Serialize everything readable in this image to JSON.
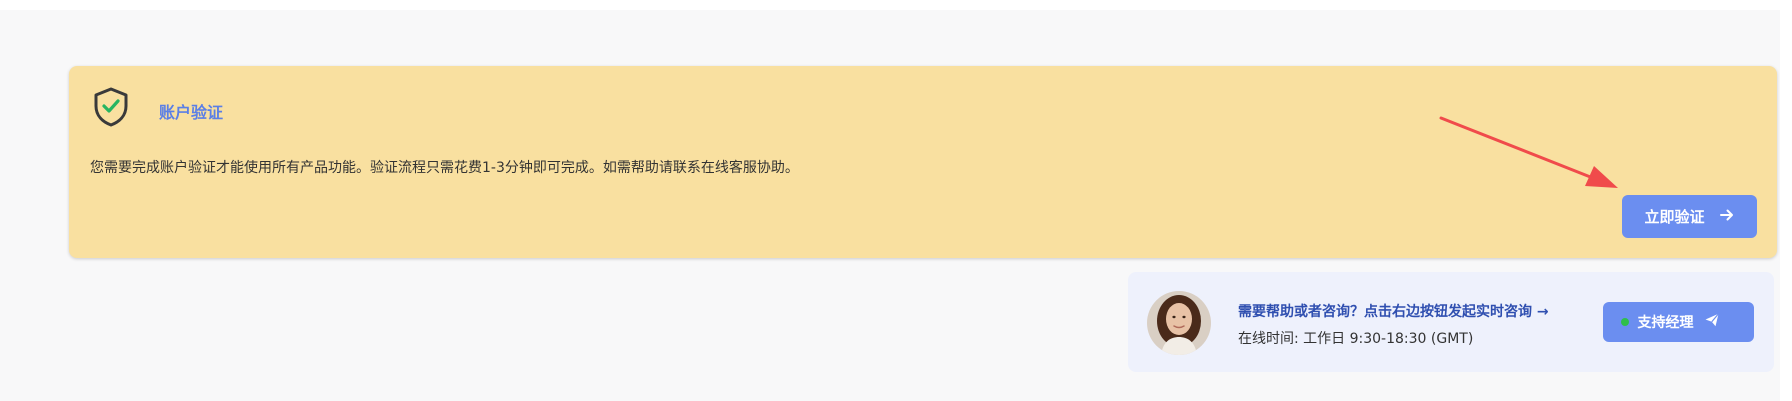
{
  "verification": {
    "title": "账户验证",
    "description": "您需要完成账户验证才能使用所有产品功能。验证流程只需花费1-3分钟即可完成。如需帮助请联系在线客服协助。",
    "button_label": "立即验证",
    "button_icon": "arrow-right-icon",
    "shield_icon": "shield-check-icon"
  },
  "support": {
    "title": "需要帮助或者咨询？点击右边按钮发起实时咨询 →",
    "hours": "在线时间: 工作日 9:30-18:30 (GMT)",
    "button_label": "支持经理",
    "button_icon": "paper-plane-icon",
    "status": "online"
  },
  "colors": {
    "card_background": "#f9e0a0",
    "accent": "#6b8ef0",
    "title_blue": "#5b7fe6",
    "support_text": "#2f4fb0",
    "annotation_arrow": "#f04b4b",
    "online_green": "#2fbf4a"
  }
}
